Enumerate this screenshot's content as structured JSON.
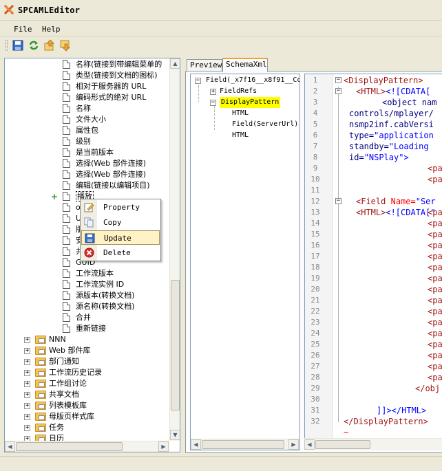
{
  "window": {
    "title": "SPCAMLEditor"
  },
  "menu": {
    "file": "File",
    "help": "Help"
  },
  "toolbar": {
    "icons": [
      "save-icon",
      "refresh-icon",
      "upload-icon",
      "download-icon"
    ]
  },
  "left_tree": {
    "field_items": [
      "名称(链接到带编辑菜单的",
      "类型(链接到文档的图标)",
      "相对于服务器的 URL",
      "编码形式的绝对 URL",
      "名称",
      "文件大小",
      "属性包",
      "级别",
      "是当前版本",
      "选择(Web 部件连接)",
      "选择(Web 部件连接)",
      "编辑(链接以编辑项目)",
      "播放",
      "o",
      "U",
      "版",
      "安",
      "共",
      "GUID",
      "工作流版本",
      "工作流实例 ID",
      "源版本(转换文档)",
      "源名称(转换文档)",
      "合并",
      "重新链接"
    ],
    "lists": [
      "NNN",
      "Web 部件库",
      "部门通知",
      "工作流历史记录",
      "工作组讨论",
      "共享文档",
      "列表模板库",
      "母版页样式库",
      "任务",
      "日历"
    ]
  },
  "context_menu": {
    "items": [
      {
        "label": "Property",
        "icon": "property-icon"
      },
      {
        "label": "Copy",
        "icon": "copy-icon"
      },
      {
        "label": "Update",
        "icon": "save-icon",
        "highlighted": true
      },
      {
        "label": "Delete",
        "icon": "delete-icon"
      }
    ]
  },
  "tabs": {
    "preview": "Preview",
    "schema_xml": "SchemaXml"
  },
  "schema_tree": {
    "root": "Field(_x7f16__x8f91__Co",
    "field_refs": "FieldRefs",
    "display_pattern": "DisplayPattern",
    "children": [
      "HTML",
      "Field(ServerUrl)",
      "HTML"
    ]
  },
  "code": {
    "line_numbers": [
      "1",
      "2",
      "3",
      "4",
      "5",
      "6",
      "7",
      "8",
      "9",
      "10",
      "11",
      "12",
      "13",
      "14",
      "15",
      "16",
      "17",
      "18",
      "19",
      "20",
      "21",
      "22",
      "23",
      "24",
      "25",
      "26",
      "27",
      "28",
      "29",
      "30",
      "31",
      "32"
    ],
    "line1": "<DisplayPattern>",
    "line2_tag": "<HTML>",
    "line2_cdata": "<![CDATA[",
    "line3": "<object nam",
    "line4": "controls/mplayer/",
    "line5": "nsmp2inf.cabVersi",
    "line6_attr": "type=",
    "line6_val": "\"application",
    "line7_attr": "standby=",
    "line7_val": "\"Loading",
    "line8_attr": "id=",
    "line8_val": "\"NSPlay\">",
    "line_pa": "<pa",
    "line11_tag": "<Field",
    "line11_attr": "Name=",
    "line11_val": "\"Ser",
    "line12_tag": "<HTML>",
    "line12_cdata": "<![CDATA[\"",
    "line29": "</obj",
    "line31": "]]></HTML>",
    "line32": "</DisplayPattern>",
    "tilde": "~"
  }
}
